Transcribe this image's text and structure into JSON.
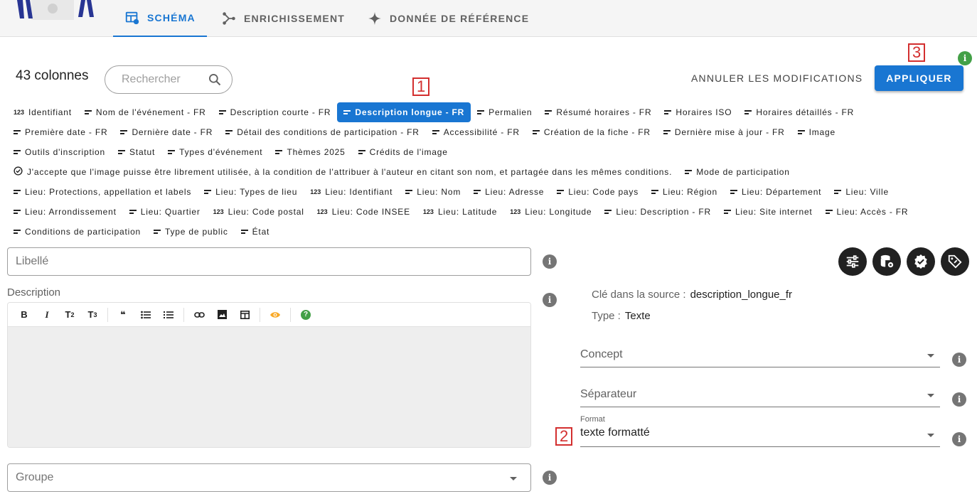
{
  "tabs": [
    {
      "label": "SCHÉMA",
      "active": true
    },
    {
      "label": "ENRICHISSEMENT",
      "active": false
    },
    {
      "label": "DONNÉE DE RÉFÉRENCE",
      "active": false
    }
  ],
  "header": {
    "column_count": "43 colonnes",
    "search_placeholder": "Rechercher",
    "cancel_label": "ANNULER LES MODIFICATIONS",
    "apply_label": "APPLIQUER",
    "info_glyph": "i"
  },
  "markers": [
    "1",
    "2",
    "3"
  ],
  "chip_rows": [
    [
      {
        "label": "Identifiant",
        "icon": "123"
      },
      {
        "label": "Nom de l'événement - FR",
        "icon": "text"
      },
      {
        "label": "Description courte - FR",
        "icon": "text"
      },
      {
        "label": "Description longue - FR",
        "icon": "text",
        "selected": true
      },
      {
        "label": "Permalien",
        "icon": "text"
      },
      {
        "label": "Résumé horaires - FR",
        "icon": "text"
      },
      {
        "label": "Horaires ISO",
        "icon": "text"
      },
      {
        "label": "Horaires détaillés - FR",
        "icon": "text"
      }
    ],
    [
      {
        "label": "Première date - FR",
        "icon": "text"
      },
      {
        "label": "Dernière date - FR",
        "icon": "text"
      },
      {
        "label": "Détail des conditions de participation - FR",
        "icon": "text"
      },
      {
        "label": "Accessibilité - FR",
        "icon": "text"
      },
      {
        "label": "Création de la fiche - FR",
        "icon": "text"
      },
      {
        "label": "Dernière mise à jour - FR",
        "icon": "text"
      },
      {
        "label": "Image",
        "icon": "text"
      }
    ],
    [
      {
        "label": "Outils d'inscription",
        "icon": "text"
      },
      {
        "label": "Statut",
        "icon": "text"
      },
      {
        "label": "Types d'événement",
        "icon": "text"
      },
      {
        "label": "Thèmes 2025",
        "icon": "text"
      },
      {
        "label": "Crédits de l'image",
        "icon": "text"
      }
    ],
    [
      {
        "label": "J'accepte que l'image puisse être librement utilisée, à la condition de l'attribuer à l'auteur en citant son nom, et partagée dans les mêmes conditions.",
        "icon": "check"
      },
      {
        "label": "Mode de participation",
        "icon": "text"
      }
    ],
    [
      {
        "label": "Lieu: Protections, appellation et labels",
        "icon": "text"
      },
      {
        "label": "Lieu: Types de lieu",
        "icon": "text"
      },
      {
        "label": "Lieu: Identifiant",
        "icon": "123"
      },
      {
        "label": "Lieu: Nom",
        "icon": "text"
      },
      {
        "label": "Lieu: Adresse",
        "icon": "text"
      },
      {
        "label": "Lieu: Code pays",
        "icon": "text"
      },
      {
        "label": "Lieu: Région",
        "icon": "text"
      },
      {
        "label": "Lieu: Département",
        "icon": "text"
      },
      {
        "label": "Lieu: Ville",
        "icon": "text"
      }
    ],
    [
      {
        "label": "Lieu: Arrondissement",
        "icon": "text"
      },
      {
        "label": "Lieu: Quartier",
        "icon": "text"
      },
      {
        "label": "Lieu: Code postal",
        "icon": "123"
      },
      {
        "label": "Lieu: Code INSEE",
        "icon": "123"
      },
      {
        "label": "Lieu: Latitude",
        "icon": "123"
      },
      {
        "label": "Lieu: Longitude",
        "icon": "123"
      },
      {
        "label": "Lieu: Description - FR",
        "icon": "text"
      },
      {
        "label": "Lieu: Site internet",
        "icon": "text"
      },
      {
        "label": "Lieu: Accès - FR",
        "icon": "text"
      }
    ],
    [
      {
        "label": "Conditions de participation",
        "icon": "text"
      },
      {
        "label": "Type de public",
        "icon": "text"
      },
      {
        "label": "État",
        "icon": "text"
      }
    ]
  ],
  "form": {
    "libelle_placeholder": "Libellé",
    "description_label": "Description",
    "groupe_placeholder": "Groupe",
    "toolbar": {
      "bold": "B",
      "italic": "I",
      "t2": "T",
      "t2_sub": "2",
      "t3": "T",
      "t3_sub": "3",
      "quote": "❝",
      "help": "?"
    }
  },
  "details": {
    "source_key_label": "Clé dans la source :",
    "source_key_value": "description_longue_fr",
    "type_label": "Type :",
    "type_value": "Texte",
    "concept_label": "Concept",
    "separator_label": "Séparateur",
    "format_label": "Format",
    "format_value": "texte formatté"
  },
  "colors": {
    "accent": "#1976d2",
    "marker": "#d32f2f",
    "success": "#43a047"
  }
}
